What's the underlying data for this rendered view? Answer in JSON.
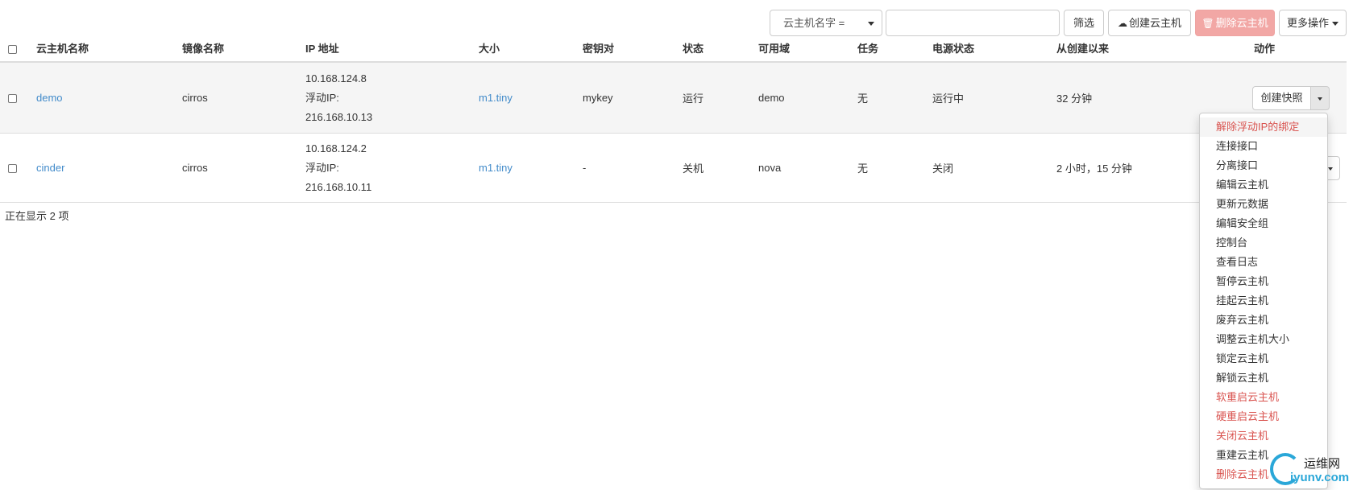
{
  "toolbar": {
    "filter_field": "云主机名字 =",
    "filter_input_value": "",
    "filter_button": "筛选",
    "create_button": "创建云主机",
    "delete_button": "删除云主机",
    "more_button": "更多操作",
    "create_icon": "cloud-upload-icon",
    "delete_icon": "trash-icon"
  },
  "table": {
    "headers": {
      "name": "云主机名称",
      "image": "镜像名称",
      "ip": "IP 地址",
      "size": "大小",
      "keypair": "密钥对",
      "status": "状态",
      "zone": "可用域",
      "task": "任务",
      "power": "电源状态",
      "age": "从创建以来",
      "actions": "动作"
    },
    "rows": [
      {
        "name": "demo",
        "image": "cirros",
        "ip_fixed": "10.168.124.8",
        "ip_float_label": "浮动IP:",
        "ip_float": "216.168.10.13",
        "size": "m1.tiny",
        "keypair": "mykey",
        "status": "运行",
        "zone": "demo",
        "task": "无",
        "power": "运行中",
        "age": "32 分钟",
        "action": "创建快照"
      },
      {
        "name": "cinder",
        "image": "cirros",
        "ip_fixed": "10.168.124.2",
        "ip_float_label": "浮动IP:",
        "ip_float": "216.168.10.11",
        "size": "m1.tiny",
        "keypair": "-",
        "status": "关机",
        "zone": "nova",
        "task": "无",
        "power": "关闭",
        "age": "2 小时，15 分钟",
        "action": ""
      }
    ]
  },
  "footer": {
    "count_text": "正在显示 2 项"
  },
  "dropdown": {
    "items": [
      "解除浮动IP的绑定",
      "连接接口",
      "分离接口",
      "编辑云主机",
      "更新元数据",
      "编辑安全组",
      "控制台",
      "查看日志",
      "暂停云主机",
      "挂起云主机",
      "废弃云主机",
      "调整云主机大小",
      "锁定云主机",
      "解锁云主机",
      "软重启云主机",
      "硬重启云主机",
      "关闭云主机",
      "重建云主机",
      "删除云主机"
    ],
    "danger_color": "#d9534f"
  },
  "watermark": {
    "line1": "运维网",
    "line2": "iyunv.com"
  },
  "colors": {
    "link": "#428bca",
    "danger": "#d9534f",
    "delete_button_bg": "#f2a7a5"
  }
}
